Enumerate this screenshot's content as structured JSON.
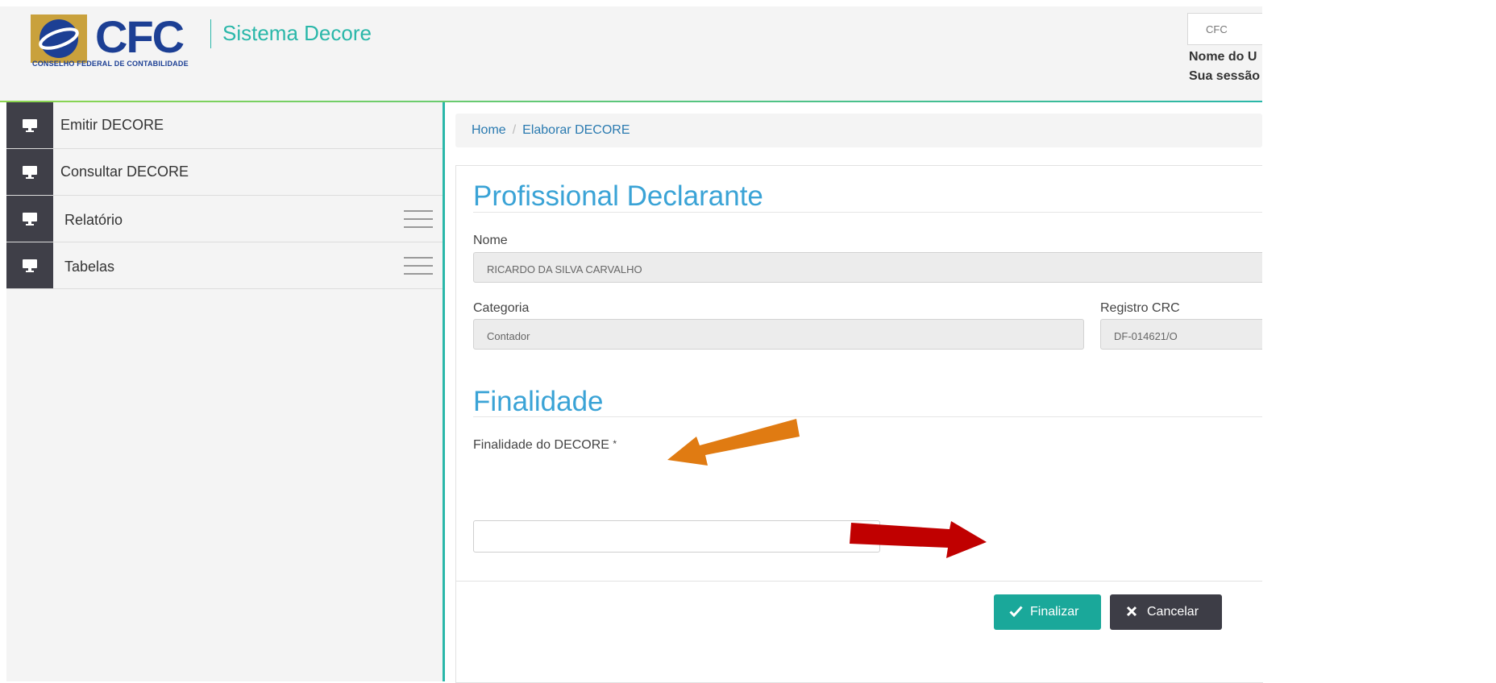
{
  "header": {
    "brand": "CFC",
    "brand_subtitle": "CONSELHO FEDERAL DE CONTABILIDADE",
    "system_name": "Sistema Decore",
    "top_right_box": "CFC",
    "user_name_partial": "Nome do U",
    "session_partial": "Sua sessão"
  },
  "sidebar": {
    "items": [
      {
        "label": "Emitir DECORE",
        "icon": "monitor-icon"
      },
      {
        "label": "Consultar DECORE",
        "icon": "monitor-icon"
      },
      {
        "label": "Relatório",
        "icon": "monitor-icon",
        "has_menu": true
      },
      {
        "label": "Tabelas",
        "icon": "monitor-icon",
        "has_menu": true
      }
    ]
  },
  "breadcrumb": {
    "home": "Home",
    "separator": "/",
    "current": "Elaborar DECORE"
  },
  "form": {
    "section1_title": "Profissional Declarante",
    "nome_label": "Nome",
    "nome_value": "RICARDO DA SILVA CARVALHO",
    "categoria_label": "Categoria",
    "categoria_value": "Contador",
    "registro_label": "Registro CRC",
    "registro_value": "DF-014621/O",
    "section2_title": "Finalidade",
    "finalidade_label": "Finalidade do DECORE",
    "required_mark": "*",
    "finalidade_value": ""
  },
  "actions": {
    "finalizar": "Finalizar",
    "cancelar": "Cancelar"
  },
  "colors": {
    "teal": "#1aa89a",
    "brand_blue": "#1c3f94",
    "section_blue": "#3aa3d6",
    "orange_arrow": "#e07b12",
    "red_arrow": "#c00000"
  }
}
